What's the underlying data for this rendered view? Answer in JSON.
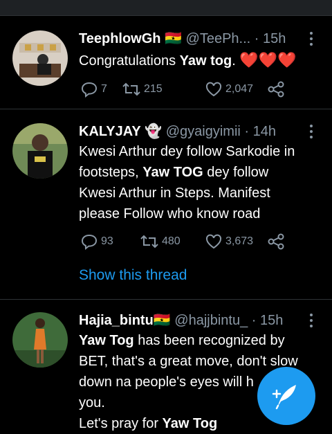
{
  "tweets": [
    {
      "name": "TeephlowGh",
      "flag": "🇬🇭",
      "handle": "@TeePh...",
      "time": "15h",
      "text_plain": "Congratulations",
      "text_bold": "Yaw tog",
      "text_after": ".",
      "emoji": "❤️❤️❤️",
      "replies": "7",
      "retweets": "215",
      "likes": "2,047"
    },
    {
      "name": "KALYJAY",
      "emoji_after_name": "👻",
      "handle": "@gyaigyimii",
      "time": "14h",
      "line1": "Kwesi Arthur dey follow Sarkodie in",
      "line2": "footsteps,",
      "line2_bold": "Yaw TOG",
      "line2_after": "dey follow",
      "line3": "Kwesi Arthur in Steps. Manifest",
      "line4": "please Follow who know road",
      "replies": "93",
      "retweets": "480",
      "likes": "3,673",
      "thread_link": "Show this thread"
    },
    {
      "name": "Hajia_bintu",
      "flag": "🇬🇭",
      "handle": "@hajjbintu_",
      "time": "15h",
      "line1_bold": "Yaw Tog",
      "line1": "has been recognized by",
      "line2": "BET, that's a great move, don't slow",
      "line3": "down na people's eyes will h",
      "line4": "you.",
      "line5": "Let's pray for",
      "line5_bold": "Yaw Tog"
    }
  ],
  "icons": {
    "reply": "reply-icon",
    "retweet": "retweet-icon",
    "like": "heart-icon",
    "share": "share-icon",
    "more": "more-vertical-icon",
    "compose": "compose-tweet-icon"
  },
  "colors": {
    "background": "#000000",
    "secondary_text": "#8b98a5",
    "link": "#1d9bf0",
    "heart": "#e0245e",
    "divider": "#2f3336"
  }
}
